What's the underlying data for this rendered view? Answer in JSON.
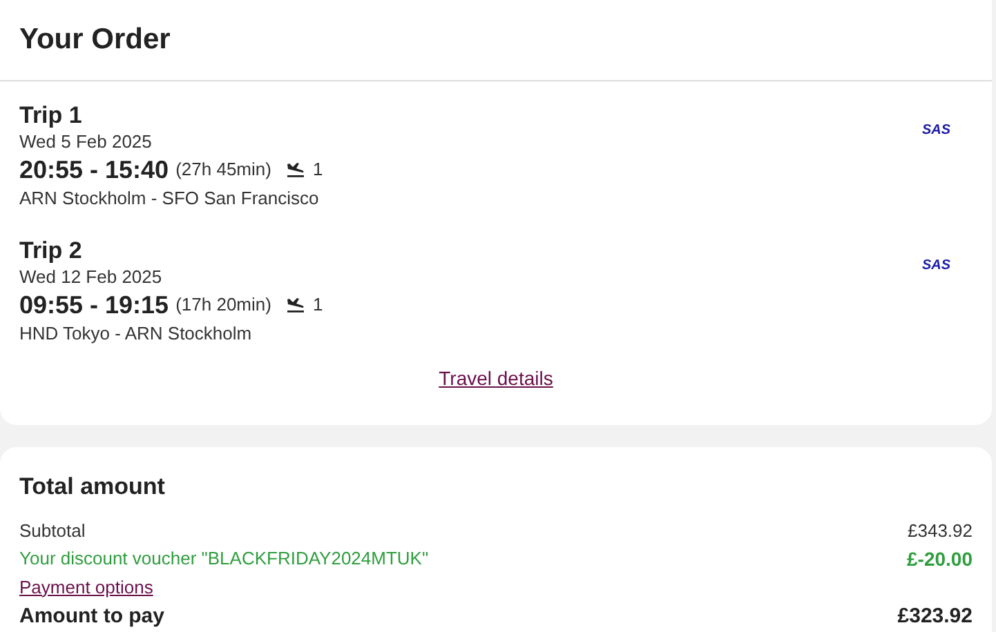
{
  "order": {
    "title": "Your Order",
    "trips": [
      {
        "title": "Trip 1",
        "date": "Wed 5 Feb 2025",
        "times": "20:55 - 15:40",
        "duration": "(27h 45min)",
        "stops": "1",
        "route": "ARN Stockholm - SFO San Francisco",
        "airline": "SAS"
      },
      {
        "title": "Trip 2",
        "date": "Wed 12 Feb 2025",
        "times": "09:55 - 19:15",
        "duration": "(17h 20min)",
        "stops": "1",
        "route": "HND Tokyo - ARN Stockholm",
        "airline": "SAS"
      }
    ],
    "details_link": "Travel details"
  },
  "total": {
    "title": "Total amount",
    "lines": [
      {
        "kind": "normal",
        "label": "Subtotal",
        "amount": "£343.92"
      },
      {
        "kind": "discount",
        "label": "Your discount voucher \"BLACKFRIDAY2024MTUK\"",
        "amount": "£-20.00"
      },
      {
        "kind": "link",
        "label": "Payment options"
      },
      {
        "kind": "total",
        "label": "Amount to pay",
        "amount": "£323.92"
      }
    ]
  }
}
